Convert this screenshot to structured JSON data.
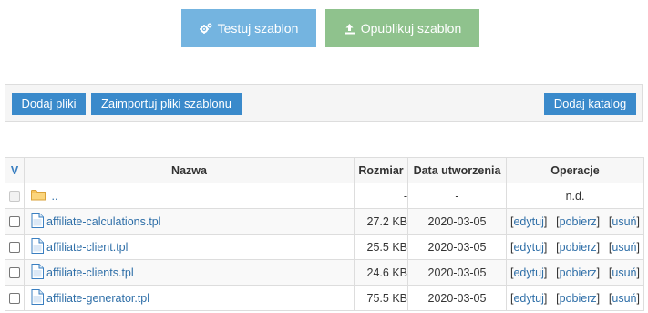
{
  "actions": {
    "test_label": "Testuj szablon",
    "publish_label": "Opublikuj szablon"
  },
  "toolbar": {
    "add_files_label": "Dodaj pliki",
    "import_label": "Zaimportuj pliki szablonu",
    "add_dir_label": "Dodaj katalog"
  },
  "table": {
    "headers": {
      "select": "V",
      "name": "Nazwa",
      "size": "Rozmiar",
      "date": "Data utworzenia",
      "ops": "Operacje"
    },
    "parent_row": {
      "name": "..",
      "size": "-",
      "date": "-",
      "ops": "n.d."
    },
    "rows": [
      {
        "name": "affiliate-calculations.tpl",
        "size": "27.2 KB",
        "date": "2020-03-05"
      },
      {
        "name": "affiliate-client.tpl",
        "size": "25.5 KB",
        "date": "2020-03-05"
      },
      {
        "name": "affiliate-clients.tpl",
        "size": "24.6 KB",
        "date": "2020-03-05"
      },
      {
        "name": "affiliate-generator.tpl",
        "size": "75.5 KB",
        "date": "2020-03-05"
      }
    ],
    "op_labels": {
      "edit": "edytuj",
      "download": "pobierz",
      "delete": "usuń"
    }
  },
  "icons": {
    "test": "gears-icon",
    "publish": "upload-icon",
    "folder": "folder-icon",
    "file": "file-icon"
  },
  "colors": {
    "test_button": "#74b4e0",
    "publish_button": "#8fc28d",
    "toolbar_button": "#3a8acb",
    "link": "#2f6fa8"
  }
}
